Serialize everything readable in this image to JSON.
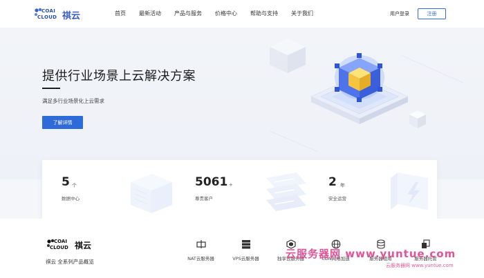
{
  "header": {
    "logo_text": "祺云",
    "logo_mark_top": "COAI",
    "logo_mark_bottom": "CLOUD",
    "nav": [
      "首页",
      "最新活动",
      "产品与服务",
      "价格中心",
      "帮助与支持",
      "关于我们"
    ],
    "login_label": "用户登录",
    "register_label": "注册"
  },
  "hero": {
    "title": "提供行业场景上云解决方案",
    "subtitle": "满足多行业场景化上云需求",
    "button_label": "了解详情"
  },
  "stats": [
    {
      "value": "5",
      "unit": "个",
      "label": "数据中心"
    },
    {
      "value": "5061",
      "unit": "+",
      "label": "尊贵客户"
    },
    {
      "value": "2",
      "unit": "年",
      "label": "安全运营"
    }
  ],
  "bottom": {
    "logo_text": "祺云",
    "logo_mark_top": "COAI",
    "logo_mark_bottom": "CLOUD",
    "title": "祺云 全系列产品概览",
    "products": [
      {
        "label": "NAT云服务器",
        "icon": "nat-server-icon"
      },
      {
        "label": "VPS云服务器",
        "icon": "vps-server-icon"
      },
      {
        "label": "独享云服务器",
        "icon": "dedicated-server-icon"
      },
      {
        "label": "CDN网络加速",
        "icon": "cdn-globe-icon"
      },
      {
        "label": "服务器租用",
        "icon": "server-rental-icon"
      },
      {
        "label": "服务器托管",
        "icon": "server-hosting-icon"
      }
    ]
  },
  "watermark": {
    "main": "云服务器网 www.yuntue.com",
    "sub": "云服务器网 www.yuntue.com"
  },
  "colors": {
    "accent": "#2f6ad9",
    "cube_yellow": "#f5c542",
    "cube_blue": "#3b6cf0",
    "watermark": "#e0468f"
  }
}
